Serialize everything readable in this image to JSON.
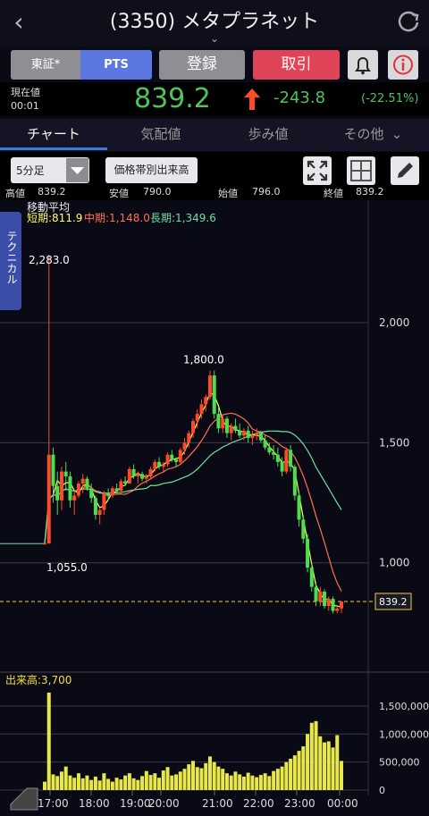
{
  "header": {
    "back_icon": "‹",
    "title": "(3350) メタプラネット",
    "expand_icon": "⌄"
  },
  "actions": {
    "market_tosho": "東証*",
    "market_pts": "PTS",
    "register": "登録",
    "trade": "取引"
  },
  "quote": {
    "current_label": "現在値",
    "time": "00:01",
    "price": "839.2",
    "change": "-243.8",
    "change_pct": "(-22.51%)",
    "price_color": "#4fc35b",
    "arrow_color": "#ff4a2a"
  },
  "tabs": [
    "チャート",
    "気配値",
    "歩み値",
    "その他"
  ],
  "tabs_more_icon": "⌄",
  "toolbar": {
    "period": "5分足",
    "volume_by_price": "価格帯別出来高"
  },
  "ohlc": {
    "high_label": "高値",
    "high": "839.2",
    "low_label": "安値",
    "low": "790.0",
    "open_label": "始値",
    "open": "796.0",
    "close_label": "終値",
    "close": "839.2"
  },
  "technical_tab": "テクニカル",
  "moving_average": {
    "title": "移動平均",
    "short": "短期:811.9",
    "mid": "中期:1,148.0",
    "long": "長期:1,349.6",
    "short_color": "#ffff66",
    "mid_color": "#ff7050",
    "long_color": "#70e0a0"
  },
  "chart_data": {
    "type": "candlestick",
    "price_axis": {
      "ticks": [
        "2,000",
        "1,500",
        "1,000"
      ],
      "values": [
        2000,
        1500,
        1000
      ],
      "range": [
        560,
        2450
      ]
    },
    "volume_axis": {
      "ticks": [
        "1,500,000",
        "1,000,000",
        "500,000",
        "0"
      ],
      "values": [
        1500000,
        1000000,
        500000,
        0
      ],
      "range": [
        0,
        1850000
      ]
    },
    "time_ticks": [
      "17:00",
      "18:00",
      "19:00",
      "20:00",
      "21:00",
      "22:00",
      "23:00",
      "00:00"
    ],
    "annotations": {
      "high": "2,283.0",
      "low": "1,055.0",
      "peak": "1,800.0",
      "current": "839.2"
    },
    "volume_label": "出来高:3,700",
    "candles": [
      [
        1080,
        1080,
        1080,
        1080
      ],
      [
        1080,
        2283,
        1100,
        1450
      ],
      [
        1450,
        1480,
        1250,
        1320
      ],
      [
        1320,
        1380,
        1200,
        1260
      ],
      [
        1260,
        1400,
        1220,
        1380
      ],
      [
        1380,
        1420,
        1300,
        1360
      ],
      [
        1360,
        1380,
        1230,
        1260
      ],
      [
        1260,
        1300,
        1200,
        1280
      ],
      [
        1280,
        1340,
        1270,
        1330
      ],
      [
        1330,
        1370,
        1290,
        1350
      ],
      [
        1350,
        1360,
        1300,
        1310
      ],
      [
        1310,
        1330,
        1250,
        1270
      ],
      [
        1270,
        1280,
        1180,
        1200
      ],
      [
        1200,
        1230,
        1160,
        1220
      ],
      [
        1220,
        1300,
        1200,
        1290
      ],
      [
        1290,
        1310,
        1260,
        1280
      ],
      [
        1280,
        1320,
        1270,
        1310
      ],
      [
        1310,
        1330,
        1290,
        1300
      ],
      [
        1300,
        1350,
        1290,
        1340
      ],
      [
        1340,
        1360,
        1320,
        1330
      ],
      [
        1330,
        1400,
        1330,
        1390
      ],
      [
        1390,
        1410,
        1350,
        1360
      ],
      [
        1360,
        1380,
        1330,
        1370
      ],
      [
        1370,
        1380,
        1340,
        1350
      ],
      [
        1350,
        1370,
        1330,
        1360
      ],
      [
        1360,
        1400,
        1350,
        1390
      ],
      [
        1390,
        1430,
        1380,
        1420
      ],
      [
        1420,
        1440,
        1390,
        1400
      ],
      [
        1400,
        1420,
        1380,
        1410
      ],
      [
        1410,
        1460,
        1400,
        1450
      ],
      [
        1450,
        1470,
        1420,
        1430
      ],
      [
        1430,
        1440,
        1400,
        1420
      ],
      [
        1420,
        1480,
        1410,
        1470
      ],
      [
        1470,
        1520,
        1450,
        1500
      ],
      [
        1500,
        1550,
        1480,
        1540
      ],
      [
        1540,
        1600,
        1520,
        1590
      ],
      [
        1590,
        1640,
        1560,
        1620
      ],
      [
        1620,
        1680,
        1600,
        1660
      ],
      [
        1660,
        1700,
        1630,
        1690
      ],
      [
        1690,
        1800,
        1680,
        1780
      ],
      [
        1780,
        1800,
        1600,
        1620
      ],
      [
        1620,
        1650,
        1540,
        1560
      ],
      [
        1560,
        1620,
        1540,
        1600
      ],
      [
        1600,
        1610,
        1520,
        1540
      ],
      [
        1540,
        1580,
        1510,
        1570
      ],
      [
        1570,
        1600,
        1540,
        1550
      ],
      [
        1550,
        1580,
        1520,
        1530
      ],
      [
        1530,
        1560,
        1510,
        1550
      ],
      [
        1550,
        1570,
        1500,
        1520
      ],
      [
        1520,
        1550,
        1490,
        1530
      ],
      [
        1530,
        1560,
        1510,
        1540
      ],
      [
        1540,
        1550,
        1500,
        1510
      ],
      [
        1510,
        1530,
        1470,
        1480
      ],
      [
        1480,
        1500,
        1450,
        1460
      ],
      [
        1460,
        1490,
        1430,
        1450
      ],
      [
        1450,
        1480,
        1400,
        1420
      ],
      [
        1420,
        1440,
        1360,
        1380
      ],
      [
        1380,
        1480,
        1370,
        1470
      ],
      [
        1470,
        1490,
        1380,
        1400
      ],
      [
        1400,
        1410,
        1260,
        1280
      ],
      [
        1280,
        1300,
        1150,
        1180
      ],
      [
        1180,
        1200,
        1080,
        1100
      ],
      [
        1100,
        1120,
        960,
        980
      ],
      [
        980,
        1000,
        880,
        900
      ],
      [
        900,
        920,
        820,
        840
      ],
      [
        840,
        900,
        820,
        880
      ],
      [
        880,
        890,
        810,
        820
      ],
      [
        820,
        860,
        800,
        850
      ],
      [
        850,
        860,
        790,
        800
      ],
      [
        800,
        820,
        790,
        810
      ],
      [
        810,
        839,
        790,
        839
      ]
    ],
    "volumes": [
      150000,
      1740000,
      280000,
      250000,
      330000,
      420000,
      260000,
      220000,
      300000,
      210000,
      260000,
      180000,
      240000,
      170000,
      300000,
      200000,
      150000,
      220000,
      190000,
      260000,
      300000,
      210000,
      180000,
      250000,
      340000,
      270000,
      300000,
      220000,
      350000,
      410000,
      260000,
      280000,
      330000,
      380000,
      460000,
      520000,
      410000,
      390000,
      480000,
      600000,
      500000,
      420000,
      380000,
      300000,
      260000,
      330000,
      280000,
      240000,
      310000,
      260000,
      230000,
      270000,
      300000,
      250000,
      340000,
      380000,
      420000,
      500000,
      560000,
      620000,
      700000,
      780000,
      1000000,
      1200000,
      1230000,
      960000,
      850000,
      870000,
      760000,
      980000,
      520000
    ]
  }
}
